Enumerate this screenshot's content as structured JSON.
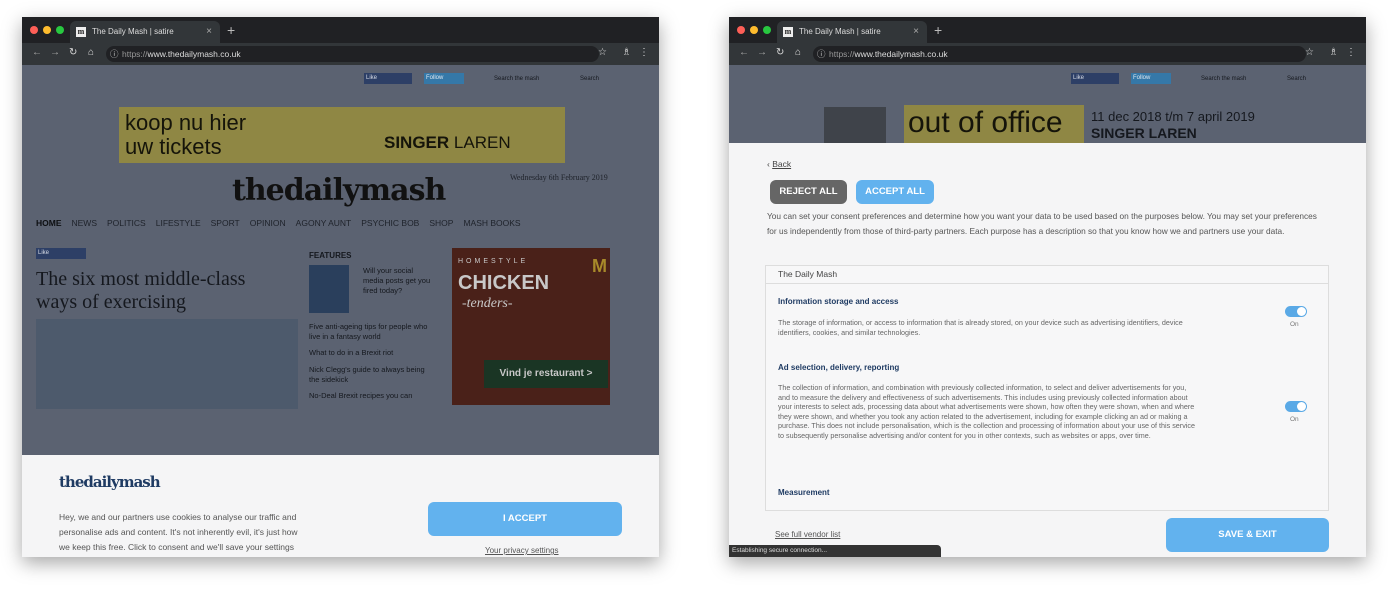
{
  "colors": {
    "accent": "#5aaee9",
    "reject": "#666666",
    "chrome_dark": "#202124"
  },
  "browser": {
    "tab_title": "The Daily Mash | satire",
    "favicon": "m",
    "url_scheme": "https://",
    "url_host": "www.thedailymash.co.uk",
    "new_tab": "+",
    "close": "×"
  },
  "left": {
    "site": {
      "like": "Like",
      "follow": "Follow",
      "search_placeholder": "Search the mash",
      "search_btn": "Search",
      "ad_line1": "koop nu hier",
      "ad_line2": "uw tickets",
      "ad_brand": "SINGER",
      "ad_brand2": "LAREN",
      "logo": "thedailymash",
      "date": "Wednesday 6th February 2019",
      "nav": [
        "HOME",
        "NEWS",
        "POLITICS",
        "LIFESTYLE",
        "SPORT",
        "OPINION",
        "AGONY AUNT",
        "PSYCHIC BOB",
        "SHOP",
        "MASH BOOKS"
      ],
      "headline": "The six most middle-class ways of exercising",
      "features_title": "FEATURES",
      "features": [
        "Will your social media posts get you fired today?",
        "Five anti-ageing tips for people who live in a fantasy world",
        "What to do in a Brexit riot",
        "Nick Clegg's guide to always being the sidekick",
        "No-Deal Brexit recipes you can"
      ],
      "side_ad_1": "HOMESTYLE",
      "side_ad_2": "CHICKEN",
      "side_ad_3": "-tenders-",
      "side_ad_cta": "Vind je restaurant >"
    },
    "banner": {
      "logo": "thedailymash",
      "text": "Hey, we and our partners use cookies to analyse our traffic and personalise ads and content. It's not inherently evil, it's just how we keep this free. Click to consent and we'll save your settings (you can always change them later).",
      "accept": "I ACCEPT",
      "privacy": "Your privacy settings"
    }
  },
  "right": {
    "site": {
      "like": "Like",
      "follow": "Follow",
      "search_placeholder": "Search the mash",
      "search_btn": "Search",
      "ad_main": "out of office",
      "ad_dates": "11 dec 2018 t/m 7 april 2019",
      "ad_brand": "SINGER LAREN"
    },
    "panel": {
      "back": "Back",
      "reject_all": "REJECT ALL",
      "accept_all": "ACCEPT ALL",
      "intro": "You can set your consent preferences and determine how you want your data to be used based on the purposes below. You may set your preferences for us independently from those of third-party partners. Each purpose has a description so that you know how we and partners use your data.",
      "section_title": "The Daily Mash",
      "purposes": [
        {
          "title": "Information storage and access",
          "desc": "The storage of information, or access to information that is already stored, on your device such as advertising identifiers, device identifiers, cookies, and similar technologies.",
          "state": "On"
        },
        {
          "title": "Ad selection, delivery, reporting",
          "desc": "The collection of information, and combination with previously collected information, to select and deliver advertisements for you, and to measure the delivery and effectiveness of such advertisements. This includes using previously collected information about your interests to select ads, processing data about what advertisements were shown, how often they were shown, when and where they were shown, and whether you took any action related to the advertisement, including for example clicking an ad or making a purchase. This does not include personalisation, which is the collection and processing of information about your use of this service to subsequently personalise advertising and/or content for you in other contexts, such as websites or apps, over time.",
          "state": "On"
        },
        {
          "title": "Measurement"
        }
      ],
      "vendor_link": "See full vendor list",
      "save_exit": "SAVE & EXIT",
      "status": "Establishing secure connection..."
    }
  }
}
